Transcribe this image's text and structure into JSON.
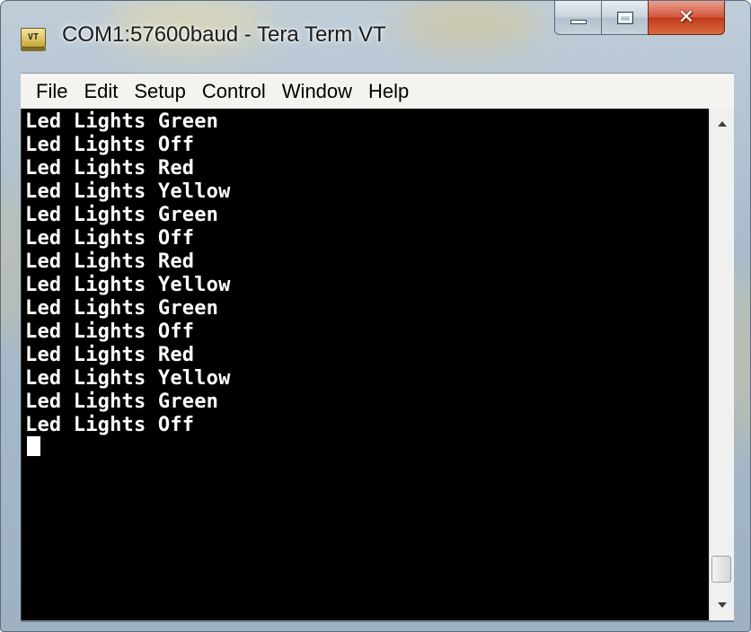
{
  "window": {
    "title": "COM1:57600baud - Tera Term VT",
    "icon": "tera-term-icon",
    "icon_label": "VT"
  },
  "menu": {
    "items": [
      {
        "label": "File"
      },
      {
        "label": "Edit"
      },
      {
        "label": "Setup"
      },
      {
        "label": "Control"
      },
      {
        "label": "Window"
      },
      {
        "label": "Help"
      }
    ]
  },
  "terminal": {
    "lines": [
      "Led Lights Green",
      "Led Lights Off",
      "Led Lights Red",
      "Led Lights Yellow",
      "Led Lights Green",
      "Led Lights Off",
      "Led Lights Red",
      "Led Lights Yellow",
      "Led Lights Green",
      "Led Lights Off",
      "Led Lights Red",
      "Led Lights Yellow",
      "Led Lights Green",
      "Led Lights Off"
    ],
    "background_color": "#000000",
    "text_color": "#ffffff"
  },
  "colors": {
    "close_button": "#c13a1c",
    "frame": "#a9bccb"
  }
}
